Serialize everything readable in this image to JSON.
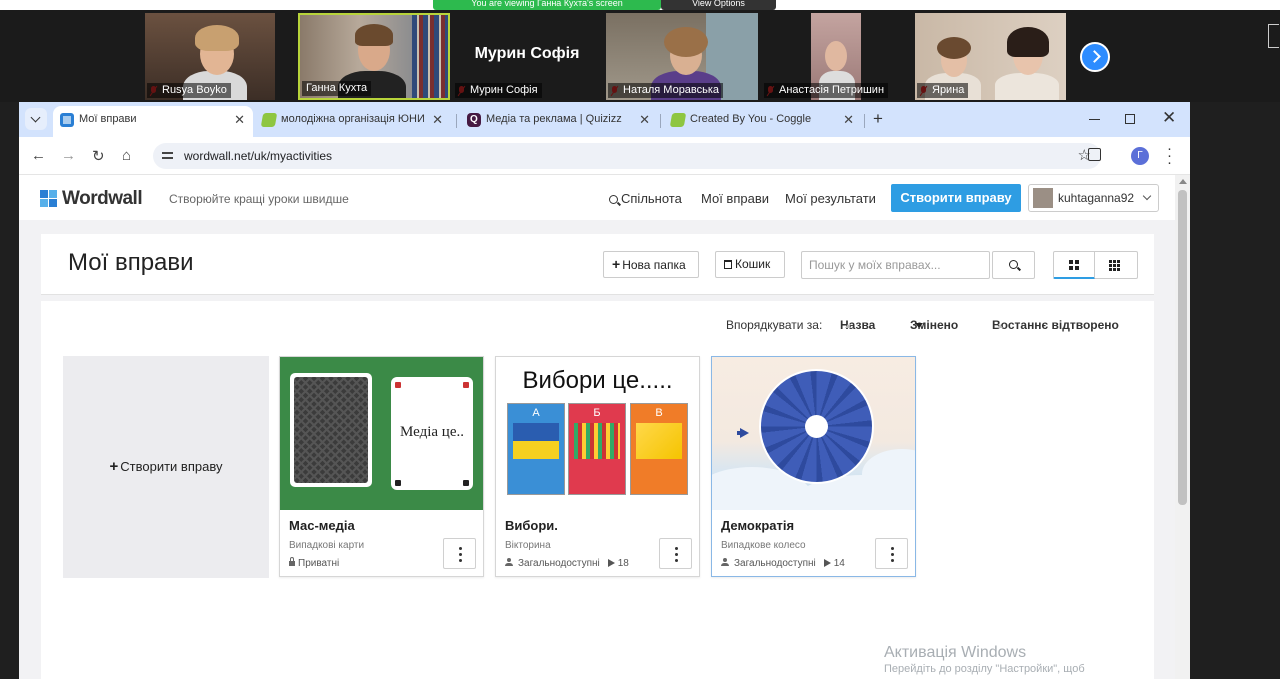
{
  "zoom": {
    "share_banner": "You are viewing Ганна Кухта's screen",
    "view_options": "View Options",
    "participants": [
      {
        "name": "Rusya Boyko"
      },
      {
        "name": "Ганна Кухта"
      },
      {
        "name": "Мурин Софія",
        "display_name": "Мурин Софія"
      },
      {
        "name": "Наталя Моравська"
      },
      {
        "name": "Анастасія Петришин"
      },
      {
        "name": "Ярина"
      }
    ]
  },
  "browser": {
    "tabs": [
      {
        "title": "Мої вправи",
        "close": "✕"
      },
      {
        "title": "молодіжна організація ЮНИ",
        "close": "✕"
      },
      {
        "title": "Медіа та реклама | Quizizz",
        "close": "✕"
      },
      {
        "title": "Created By You - Coggle",
        "close": "✕"
      }
    ],
    "new_tab": "+",
    "url": "wordwall.net/uk/myactivities",
    "profile_initial": "Г"
  },
  "site": {
    "logo_text": "Wordwall",
    "tagline": "Створюйте кращі уроки швидше",
    "nav": {
      "community": "Спільнота",
      "my_activities": "Мої вправи",
      "my_results": "Мої результати"
    },
    "create_button": "Створити вправу",
    "username": "kuhtaganna92"
  },
  "page": {
    "title": "Мої вправи",
    "new_folder": "Нова папка",
    "trash": "Кошик",
    "search_placeholder": "Пошук у моїх вправах...",
    "sort": {
      "label": "Впорядкувати за:",
      "name": "Назва",
      "modified": "Змінено",
      "last_opened": "Востаннє відтворено"
    },
    "create_card": "Створити вправу"
  },
  "activities": [
    {
      "title": "Мас-медіа",
      "type": "Випадкові карти",
      "visibility": "Приватні",
      "plays": "",
      "thumb_text": "Медіа це.."
    },
    {
      "title": "Вибори.",
      "type": "Вікторина",
      "visibility": "Загальнодоступні",
      "plays": "18",
      "thumb_text": "Вибори це.....",
      "options": [
        "А",
        "Б",
        "В"
      ]
    },
    {
      "title": "Демократія",
      "type": "Випадкове колесо",
      "visibility": "Загальнодоступні",
      "plays": "14"
    }
  ],
  "os": {
    "activation_title": "Активація Windows",
    "activation_sub": "Перейдіть до розділу \"Настройки\", щоб"
  },
  "colors": {
    "accent": "#2e9de3",
    "felt": "#3b8a47",
    "wheel": "#3f5db8",
    "tabbar": "#d3e3fd"
  }
}
